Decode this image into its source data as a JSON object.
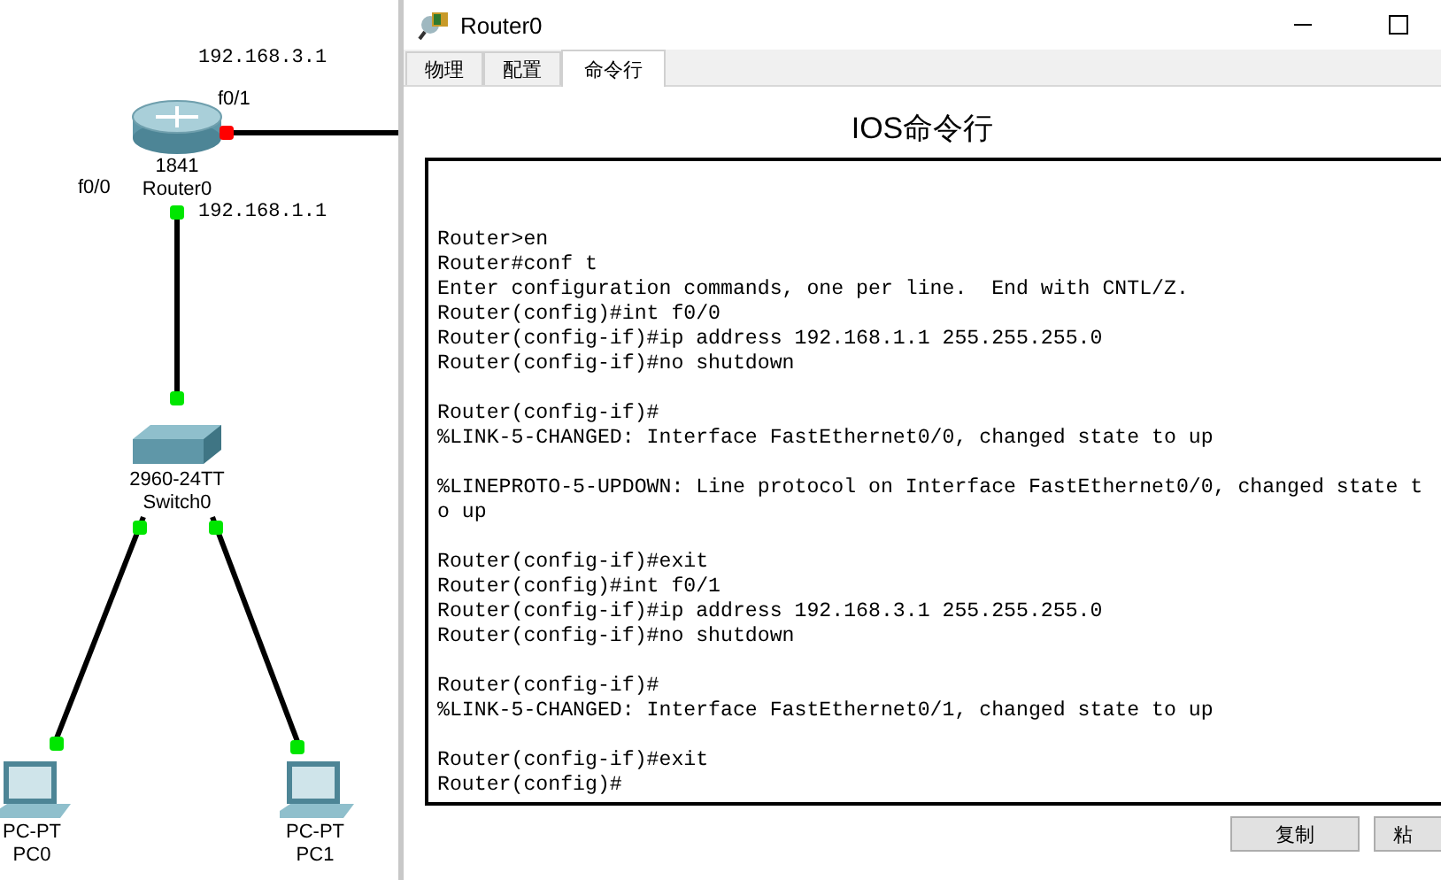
{
  "topology": {
    "labels": [
      "192.168.3.1",
      "f0/1",
      "f0/0",
      "192.168.1.1"
    ],
    "devices": [
      {
        "kind": "router",
        "model": "1841",
        "name": "Router0"
      },
      {
        "kind": "switch",
        "model": "2960-24TT",
        "name": "Switch0"
      },
      {
        "kind": "pc",
        "model": "PC-PT",
        "name": "PC0"
      },
      {
        "kind": "pc",
        "model": "PC-PT",
        "name": "PC1"
      }
    ],
    "links": [
      {
        "lights": [
          {
            "color": "#ff0000"
          }
        ]
      },
      {
        "lights": [
          {
            "color": "#00e600"
          },
          {
            "color": "#00e600"
          }
        ]
      },
      {
        "lights": [
          {
            "color": "#00e600"
          },
          {
            "color": "#00e600"
          }
        ]
      },
      {
        "lights": [
          {
            "color": "#00e600"
          },
          {
            "color": "#00e600"
          }
        ]
      }
    ]
  },
  "window": {
    "title": "Router0",
    "tabs": [
      {
        "label": "物理",
        "selected": false
      },
      {
        "label": "配置",
        "selected": false
      },
      {
        "label": "命令行",
        "selected": true
      }
    ],
    "heading": "IOS命令行",
    "terminal": [
      [
        "Router>en",
        "Router#conf t",
        "Enter configuration commands, one per line.  End with CNTL/Z.",
        "Router(config)#int f0/0",
        "Router(config-if)#ip address 192.168.1.1 255.255.255.0",
        "Router(config-if)#no shutdown"
      ],
      [
        "Router(config-if)#",
        "%LINK-5-CHANGED: Interface FastEthernet0/0, changed state to up"
      ],
      [
        "%LINEPROTO-5-UPDOWN: Line protocol on Interface FastEthernet0/0, changed state t",
        "o up"
      ],
      [
        "Router(config-if)#exit",
        "Router(config)#int f0/1",
        "Router(config-if)#ip address 192.168.3.1 255.255.255.0",
        "Router(config-if)#no shutdown"
      ],
      [
        "Router(config-if)#",
        "%LINK-5-CHANGED: Interface FastEthernet0/1, changed state to up"
      ],
      [
        "Router(config-if)#exit",
        "Router(config)#"
      ]
    ],
    "buttons": [
      "复制",
      "粘"
    ]
  }
}
